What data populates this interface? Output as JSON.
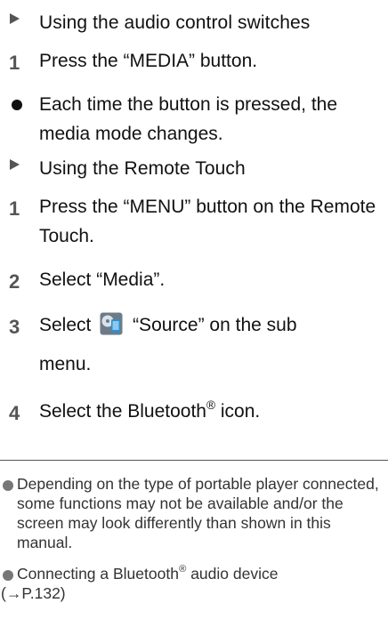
{
  "section1": {
    "heading": "Using the audio control switches",
    "step1": {
      "number": "1",
      "text": "Press the “MEDIA” button."
    },
    "bullet": "Each time the button is pressed, the media mode changes."
  },
  "section2": {
    "heading": "Using the Remote Touch",
    "step1": {
      "number": "1",
      "text": "Press the “MENU” button on the Remote Touch."
    },
    "step2": {
      "number": "2",
      "text": "Select “Media”."
    },
    "step3": {
      "number": "3",
      "text_before": "Select",
      "text_after": "“Source” on the sub",
      "text_line2": "menu.",
      "icon": "source-icon"
    },
    "step4": {
      "number": "4",
      "text_before": "Select the Bluetooth",
      "sup": "®",
      "text_after": " icon."
    }
  },
  "notes": {
    "note1": "Depending on the type of portable player connected, some functions may not be available and/or the screen may look differently than shown in this manual.",
    "note2_before": "Connecting a Bluetooth",
    "note2_sup": "®",
    "note2_after": " audio device",
    "note2_ref": "(→P.132)"
  },
  "colors": {
    "text": "#111111",
    "marker": "#555555",
    "note": "#333333",
    "icon_blue": "#2e8fd0"
  }
}
